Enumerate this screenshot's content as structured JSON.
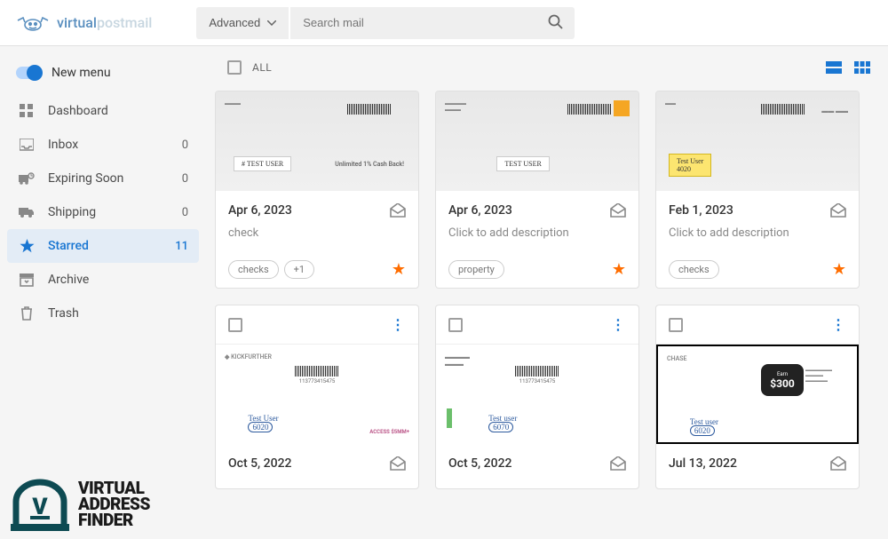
{
  "logo": {
    "virtual": "virtual",
    "post": "post",
    "mail": "mail"
  },
  "search": {
    "advanced": "Advanced",
    "placeholder": "Search mail"
  },
  "toggle": {
    "label": "New menu"
  },
  "nav": {
    "dashboard": "Dashboard",
    "inbox": {
      "label": "Inbox",
      "count": "0"
    },
    "expiring": {
      "label": "Expiring Soon",
      "count": "0"
    },
    "shipping": {
      "label": "Shipping",
      "count": "0"
    },
    "starred": {
      "label": "Starred",
      "count": "11"
    },
    "archive": "Archive",
    "trash": "Trash"
  },
  "all_label": "ALL",
  "cards": [
    {
      "date": "Apr 6, 2023",
      "desc": "check",
      "tags": [
        "checks",
        "+1"
      ],
      "env": {
        "label": "# TEST USER",
        "text": "Unlimited 1% Cash Back!"
      }
    },
    {
      "date": "Apr 6, 2023",
      "desc": "Click to add description",
      "tags": [
        "property"
      ],
      "env": {
        "label": "TEST USER"
      }
    },
    {
      "date": "Feb 1, 2023",
      "desc": "Click to add description",
      "tags": [
        "checks"
      ],
      "env": {
        "label": "Test User",
        "label2": "4020",
        "yellow": true
      }
    },
    {
      "date": "Oct 5, 2022",
      "env": {
        "sender": "KICKFURTHER",
        "label": "Test User",
        "label2": "6020",
        "extra": "ACCESS $5MM+",
        "barcode_num": "113773415475"
      }
    },
    {
      "date": "Oct 5, 2022",
      "env": {
        "label": "Test user",
        "label2": "6070",
        "barcode_num": "113773415475"
      }
    },
    {
      "date": "Jul 13, 2022",
      "env": {
        "sender": "CHASE",
        "label": "Test user",
        "label2": "6020",
        "chase_small": "Earn",
        "chase_amt": "$300"
      }
    }
  ],
  "watermark": {
    "t1": "VIRTUAL",
    "t2": "ADDRESS",
    "t3": "FINDER"
  }
}
